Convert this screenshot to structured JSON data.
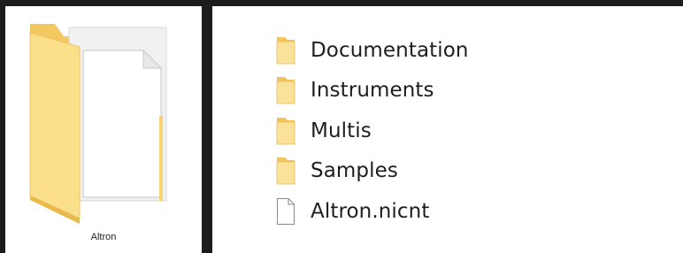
{
  "thumbnail": {
    "label": "Altron",
    "icon": "folder-with-document-icon"
  },
  "items": [
    {
      "label": "Documentation",
      "icon": "folder-icon",
      "type": "folder"
    },
    {
      "label": "Instruments",
      "icon": "folder-icon",
      "type": "folder"
    },
    {
      "label": "Multis",
      "icon": "folder-icon",
      "type": "folder"
    },
    {
      "label": "Samples",
      "icon": "folder-icon",
      "type": "folder"
    },
    {
      "label": "Altron.nicnt",
      "icon": "file-icon",
      "type": "file"
    }
  ],
  "colors": {
    "background": "#1c1c1c",
    "panel": "#ffffff",
    "folder_light": "#fbe29a",
    "folder_dark": "#f2c55c",
    "text": "#1e1e1e"
  }
}
